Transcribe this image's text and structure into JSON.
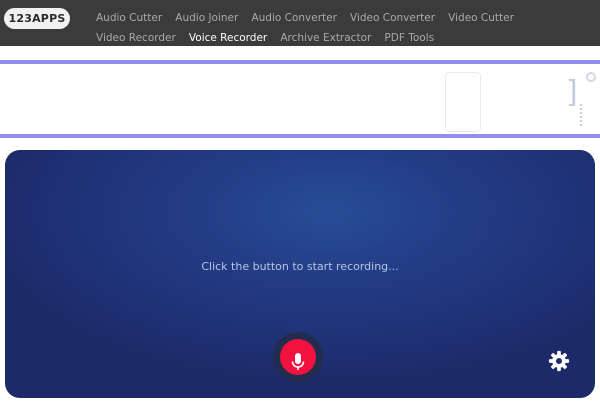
{
  "header": {
    "logo": "123APPS",
    "nav": [
      {
        "label": "Audio Cutter"
      },
      {
        "label": "Audio Joiner"
      },
      {
        "label": "Audio Converter"
      },
      {
        "label": "Video Converter"
      },
      {
        "label": "Video Cutter"
      },
      {
        "label": "Video Recorder"
      },
      {
        "label": "Voice Recorder",
        "active": true
      },
      {
        "label": "Archive Extractor"
      },
      {
        "label": "PDF Tools"
      }
    ]
  },
  "recorder": {
    "message": "Click the button to start recording...",
    "mic_icon": "microphone-icon",
    "settings_icon": "gear-icon"
  },
  "colors": {
    "topbar": "#3b3b3b",
    "nav_inactive": "#a9a9a9",
    "nav_active": "#ffffff",
    "banner_border": "#8f8ff0",
    "panel": "#223a83",
    "record_button": "#f2113f"
  }
}
